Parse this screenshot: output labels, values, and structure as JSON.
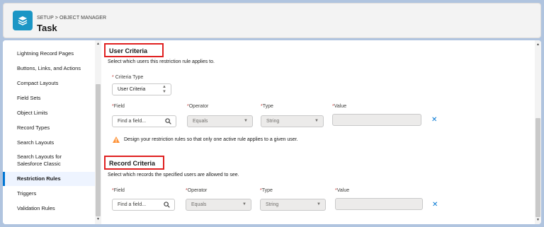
{
  "header": {
    "breadcrumb": "SETUP > OBJECT MANAGER",
    "title": "Task"
  },
  "sidebar": {
    "items": [
      {
        "label": "Lightning Record Pages"
      },
      {
        "label": "Buttons, Links, and Actions"
      },
      {
        "label": "Compact Layouts"
      },
      {
        "label": "Field Sets"
      },
      {
        "label": "Object Limits"
      },
      {
        "label": "Record Types"
      },
      {
        "label": "Search Layouts"
      },
      {
        "label": "Search Layouts for"
      },
      {
        "label": "Salesforce Classic"
      },
      {
        "label": "Restriction Rules"
      },
      {
        "label": "Triggers"
      },
      {
        "label": "Validation Rules"
      }
    ]
  },
  "user_criteria": {
    "title": "User Criteria",
    "description": "Select which users this restriction rule applies to.",
    "criteria_type_label": "Criteria Type",
    "criteria_type_value": "User Criteria",
    "field_label": "Field",
    "field_placeholder": "Find a field...",
    "operator_label": "Operator",
    "operator_value": "Equals",
    "type_label": "Type",
    "type_value": "String",
    "value_label": "Value",
    "warning": "Design your restriction rules so that only one active rule applies to a given user."
  },
  "record_criteria": {
    "title": "Record Criteria",
    "description": "Select which records the specified users are allowed to see.",
    "field_label": "Field",
    "field_placeholder": "Find a field...",
    "operator_label": "Operator",
    "operator_value": "Equals",
    "type_label": "Type",
    "type_value": "String",
    "value_label": "Value"
  },
  "required_marker": "*",
  "close_glyph": "✕",
  "colors": {
    "accent": "#0176d3",
    "highlight_box": "#e02020",
    "warning": "#fe9339",
    "header_icon": "#1b96c5"
  }
}
